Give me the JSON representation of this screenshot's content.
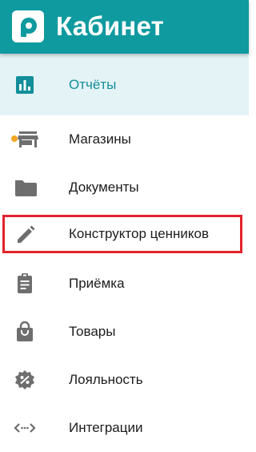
{
  "header": {
    "title": "Кабинет",
    "logo_icon": "brand-p-logo-icon",
    "background": "#0f9aa0"
  },
  "menu": {
    "items": [
      {
        "label": "Отчёты",
        "icon": "bar-chart-icon",
        "active": true
      },
      {
        "label": "Магазины",
        "icon": "store-icon",
        "badge_color": "#f5a623"
      },
      {
        "label": "Документы",
        "icon": "folder-icon"
      },
      {
        "label": "Конструктор ценников",
        "icon": "pencil-icon",
        "highlighted": true
      },
      {
        "label": "Приёмка",
        "icon": "clipboard-icon"
      },
      {
        "label": "Товары",
        "icon": "shopping-bag-icon"
      },
      {
        "label": "Лояльность",
        "icon": "discount-badge-icon"
      },
      {
        "label": "Интеграции",
        "icon": "code-brackets-icon"
      }
    ]
  },
  "colors": {
    "accent": "#138e9a",
    "active_bg": "#e3f3f6",
    "highlight": "#e3232b",
    "icon": "#6e6e6e"
  }
}
